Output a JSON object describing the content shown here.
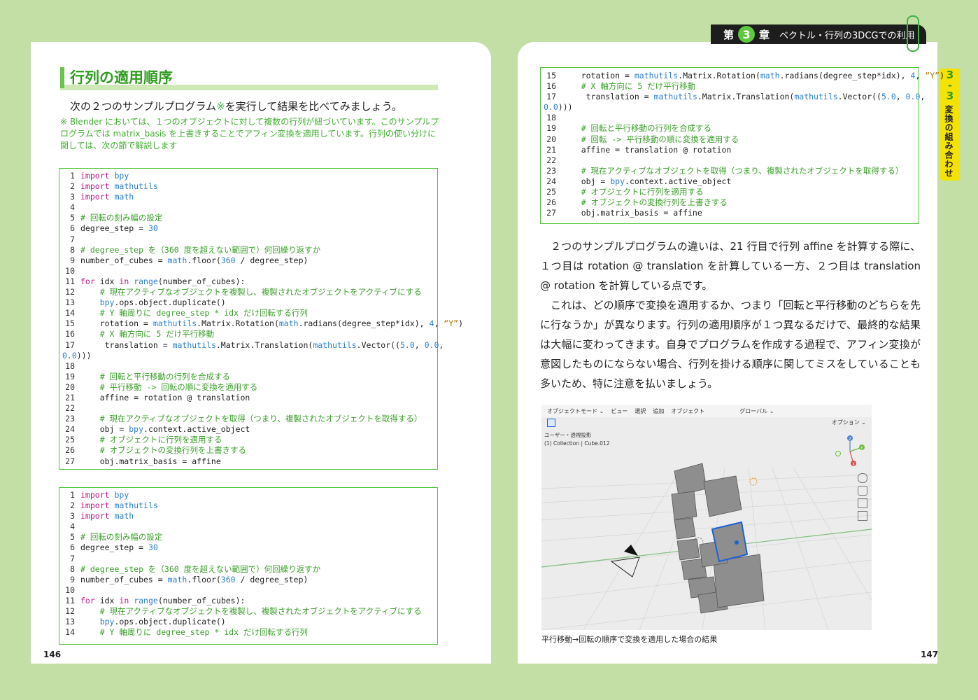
{
  "header": {
    "chapter_prefix": "第",
    "chapter_number": "3",
    "chapter_suffix": "章",
    "chapter_title": "ベクトル・行列の3DCGでの利用"
  },
  "side_tab": {
    "section_number": "3\n-\n3",
    "section_title": "変換の組み合わせ"
  },
  "left": {
    "section_title": "行列の適用順序",
    "intro": "次の２つのサンプルプログラム",
    "intro_mark": "※",
    "intro_tail": "を実行して結果を比べてみましょう。",
    "note": "※ Blender においては、１つのオブジェクトに対して複数の行列が紐づいています。このサンプルプログラムでは matrix_basis を上書きすることでアフィン変換を適用しています。行列の使い分けに関しては、次の節で解説します",
    "page_number": "146"
  },
  "code_a": [
    {
      "n": "1",
      "t": "import bpy"
    },
    {
      "n": "2",
      "t": "import mathutils"
    },
    {
      "n": "3",
      "t": "import math"
    },
    {
      "n": "4",
      "t": ""
    },
    {
      "n": "5",
      "t": "# 回転の刻み幅の設定"
    },
    {
      "n": "6",
      "t": "degree_step = 30"
    },
    {
      "n": "7",
      "t": ""
    },
    {
      "n": "8",
      "t": "# degree_step を（360 度を超えない範囲で）何回繰り返すか"
    },
    {
      "n": "9",
      "t": "number_of_cubes = math.floor(360 / degree_step)"
    },
    {
      "n": "10",
      "t": ""
    },
    {
      "n": "11",
      "t": "for idx in range(number_of_cubes):"
    },
    {
      "n": "12",
      "t": "    # 現在アクティブなオブジェクトを複製し、複製されたオブジェクトをアクティブにする"
    },
    {
      "n": "13",
      "t": "    bpy.ops.object.duplicate()"
    },
    {
      "n": "14",
      "t": "    # Y 軸周りに degree_step * idx だけ回転する行列"
    },
    {
      "n": "15",
      "t": "    rotation = mathutils.Matrix.Rotation(math.radians(degree_step*idx), 4, “Y”)"
    },
    {
      "n": "16",
      "t": "    # X 軸方向に 5 だけ平行移動"
    },
    {
      "n": "17",
      "t": "     translation = mathutils.Matrix.Translation(mathutils.Vector((5.0, 0.0,"
    },
    {
      "n": "",
      "t": "0.0)))"
    },
    {
      "n": "18",
      "t": ""
    },
    {
      "n": "19",
      "t": "    # 回転と平行移動の行列を合成する"
    },
    {
      "n": "20",
      "t": "    # 平行移動 -> 回転の順に変換を適用する"
    },
    {
      "n": "21",
      "t": "    affine = rotation @ translation"
    },
    {
      "n": "22",
      "t": ""
    },
    {
      "n": "23",
      "t": "    # 現在アクティブなオブジェクトを取得（つまり、複製されたオブジェクトを取得する）"
    },
    {
      "n": "24",
      "t": "    obj = bpy.context.active_object"
    },
    {
      "n": "25",
      "t": "    # オブジェクトに行列を適用する"
    },
    {
      "n": "26",
      "t": "    # オブジェクトの変換行列を上書きする"
    },
    {
      "n": "27",
      "t": "    obj.matrix_basis = affine"
    }
  ],
  "code_b": [
    {
      "n": "1",
      "t": "import bpy"
    },
    {
      "n": "2",
      "t": "import mathutils"
    },
    {
      "n": "3",
      "t": "import math"
    },
    {
      "n": "4",
      "t": ""
    },
    {
      "n": "5",
      "t": "# 回転の刻み幅の設定"
    },
    {
      "n": "6",
      "t": "degree_step = 30"
    },
    {
      "n": "7",
      "t": ""
    },
    {
      "n": "8",
      "t": "# degree_step を（360 度を超えない範囲で）何回繰り返すか"
    },
    {
      "n": "9",
      "t": "number_of_cubes = math.floor(360 / degree_step)"
    },
    {
      "n": "10",
      "t": ""
    },
    {
      "n": "11",
      "t": "for idx in range(number_of_cubes):"
    },
    {
      "n": "12",
      "t": "    # 現在アクティブなオブジェクトを複製し、複製されたオブジェクトをアクティブにする"
    },
    {
      "n": "13",
      "t": "    bpy.ops.object.duplicate()"
    },
    {
      "n": "14",
      "t": "    # Y 軸周りに degree_step * idx だけ回転する行列"
    }
  ],
  "code_c": [
    {
      "n": "15",
      "t": "    rotation = mathutils.Matrix.Rotation(math.radians(degree_step*idx), 4, “Y”)"
    },
    {
      "n": "16",
      "t": "    # X 軸方向に 5 だけ平行移動"
    },
    {
      "n": "17",
      "t": "     translation = mathutils.Matrix.Translation(mathutils.Vector((5.0, 0.0,"
    },
    {
      "n": "",
      "t": "0.0)))"
    },
    {
      "n": "18",
      "t": ""
    },
    {
      "n": "19",
      "t": "    # 回転と平行移動の行列を合成する"
    },
    {
      "n": "20",
      "t": "    # 回転 -> 平行移動の順に変換を適用する"
    },
    {
      "n": "21",
      "t": "    affine = translation @ rotation"
    },
    {
      "n": "22",
      "t": ""
    },
    {
      "n": "23",
      "t": "    # 現在アクティブなオブジェクトを取得（つまり、複製されたオブジェクトを取得する）"
    },
    {
      "n": "24",
      "t": "    obj = bpy.context.active_object"
    },
    {
      "n": "25",
      "t": "    # オブジェクトに行列を適用する"
    },
    {
      "n": "26",
      "t": "    # オブジェクトの変換行列を上書きする"
    },
    {
      "n": "27",
      "t": "    obj.matrix_basis = affine"
    }
  ],
  "right": {
    "para1": "２つのサンプルプログラムの違いは、21 行目で行列 affine を計算する際に、１つ目は rotation @ translation を計算している一方、２つ目は translation @ rotation を計算している点です。",
    "para2": "これは、どの順序で変換を適用するか、つまり「回転と平行移動のどちらを先に行なうか」が異なります。行列の適用順序が１つ異なるだけで、最終的な結果は大幅に変わってきます。自身でプログラムを作成する過程で、アフィン変換が意図したものにならない場合、行列を掛ける順序に関してミスをしていることも多いため、特に注意を払いましょう。",
    "caption": "平行移動→回転の順序で変換を適用した場合の結果",
    "page_number": "147"
  },
  "viewport": {
    "menu": [
      "オブジェクトモード ⌄",
      "ビュー",
      "選択",
      "追加",
      "オブジェクト"
    ],
    "transform": "グローバル ⌄",
    "options": "オプション ⌄",
    "view_name": "ユーザー・透視投影",
    "collection": "(1) Collection | Cube.012",
    "axes": {
      "x": "X",
      "y": "Y",
      "z": "Z"
    }
  }
}
